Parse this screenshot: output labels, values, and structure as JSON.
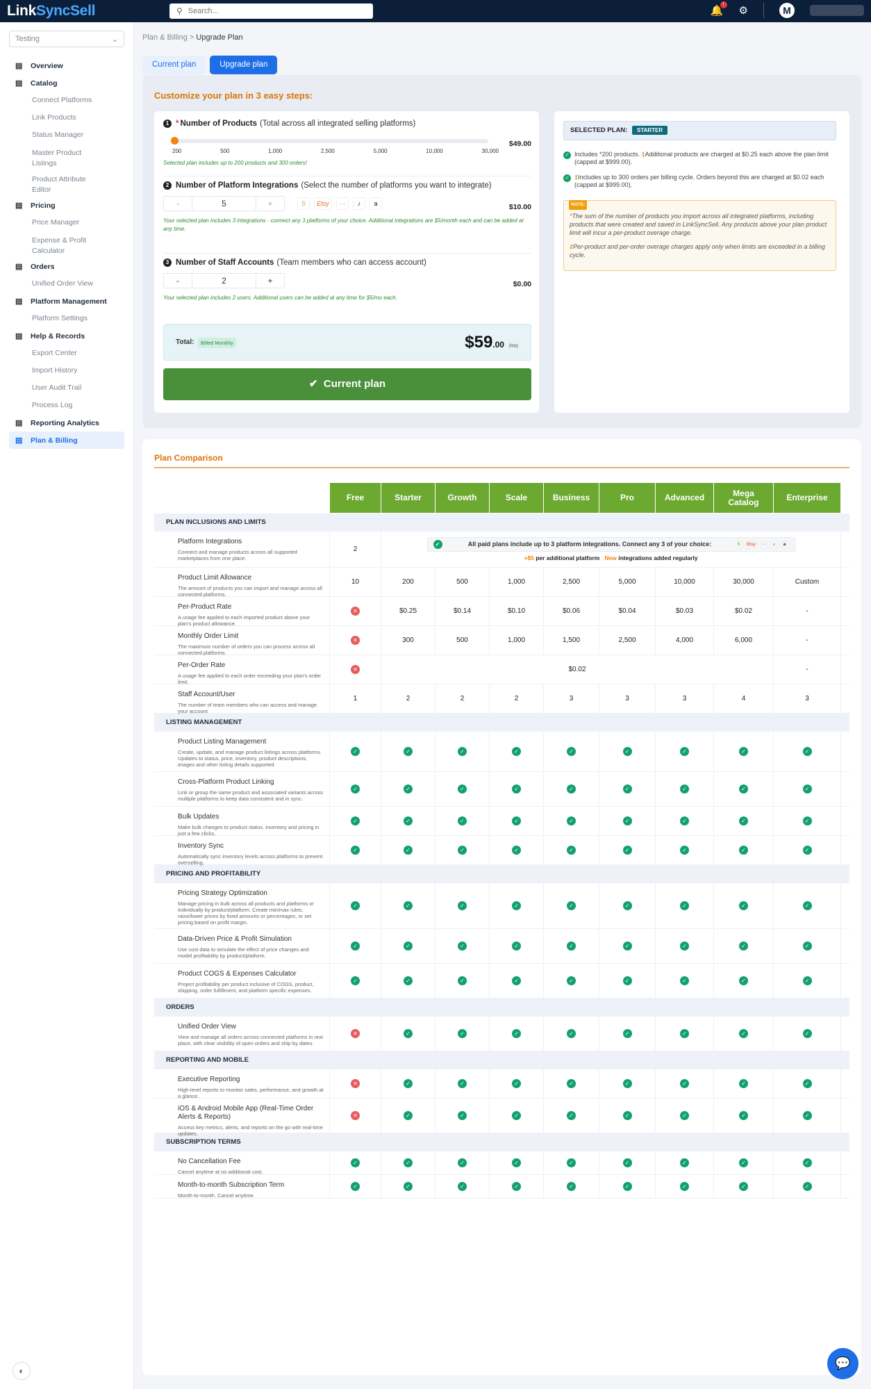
{
  "app": {
    "logo_a": "Link",
    "logo_b": "SyncSell",
    "search_placeholder": "Search...",
    "notifications": "!",
    "avatar": "M"
  },
  "sidebar": {
    "workspace": "Testing",
    "items": [
      {
        "label": "Overview",
        "icon": "document-search-icon",
        "subs": []
      },
      {
        "label": "Catalog",
        "icon": "catalog-icon",
        "subs": [
          "Connect Platforms",
          "Link Products",
          "Status Manager",
          "Master Product Listings",
          "Product Attribute Editor"
        ]
      },
      {
        "label": "Pricing",
        "icon": "pricing-icon",
        "subs": [
          "Price Manager",
          "Expense & Profit Calculator"
        ]
      },
      {
        "label": "Orders",
        "icon": "orders-icon",
        "subs": [
          "Unified Order View"
        ]
      },
      {
        "label": "Platform Management",
        "icon": "platform-icon",
        "subs": [
          "Platform Settings"
        ]
      },
      {
        "label": "Help & Records",
        "icon": "help-records-icon",
        "subs": [
          "Export Center",
          "Import History",
          "User Audit Trail",
          "Process Log"
        ]
      },
      {
        "label": "Reporting Analytics",
        "icon": "analytics-icon",
        "subs": []
      },
      {
        "label": "Plan & Billing",
        "icon": "billing-icon",
        "subs": [],
        "active": true
      }
    ]
  },
  "breadcrumb": {
    "parent": "Plan & Billing",
    "sep": ">",
    "current": "Upgrade Plan"
  },
  "tabs": {
    "current": "Current plan",
    "upgrade": "Upgrade plan"
  },
  "customize": {
    "title": "Customize your plan in 3 easy steps:",
    "step1": {
      "num": "1",
      "req": "*",
      "title": "Number of Products",
      "sub": "(Total across all integrated selling platforms)",
      "price": "$49.00",
      "ticks": [
        "200",
        "500",
        "1,000",
        "2,500",
        "5,000",
        "10,000",
        "30,000"
      ],
      "note": "Selected plan includes up to 200 products and 300 orders!"
    },
    "step2": {
      "num": "2",
      "title": "Number of Platform Integrations",
      "sub": "(Select the number of platforms you want to integrate)",
      "value": "5",
      "minus": "-",
      "plus": "+",
      "price": "$10.00",
      "note": "Your selected plan includes 3 integrations - connect any 3 platforms of your choice. Additional integrations are $5/month each and can be added at any time.",
      "logos": [
        "S",
        "Etsy",
        "···",
        "♪",
        "a"
      ]
    },
    "step3": {
      "num": "3",
      "title": "Number of Staff Accounts",
      "sub": "(Team members who can access account)",
      "value": "2",
      "minus": "-",
      "plus": "+",
      "price": "$0.00",
      "note": "Your selected plan includes 2 users. Additional users can be added at any time for $5/mo each."
    },
    "total": {
      "label": "Total:",
      "badge": "Billed Monthly",
      "amount": "$59",
      "cents": ".00",
      "per": "/mo"
    },
    "button": "Current plan",
    "selected": {
      "label": "SELECTED PLAN:",
      "plan": "STARTER",
      "inc1a": "Includes ",
      "inc1b": "*200 products. ",
      "inc1c": "‡",
      "inc1d": "Additional products are charged at $0.25 each above the plan limit (capped at $999.00).",
      "inc2a": "‡",
      "inc2b": "Includes up to 300 orders per billing cycle. Orders beyond this are charged at $0.02 each (capped at $999.00).",
      "note_tag": "NOTE:",
      "note1a": "*",
      "note1b": "The sum of the number of products you import across all integrated platforms, including products that were created and saved in LinkSyncSell. Any products above your plan product limit will incur a per-product overage charge.",
      "note2a": "‡",
      "note2b": "Per-product and per-order overage charges apply only when limits are exceeded in a billing cycle."
    }
  },
  "comparison": {
    "title": "Plan Comparison",
    "plans": [
      "Free",
      "Starter",
      "Growth",
      "Scale",
      "Business",
      "Pro",
      "Advanced",
      "Mega Catalog",
      "Enterprise"
    ],
    "sections": [
      {
        "name": "PLAN INCLUSIONS AND LIMITS",
        "rows": [
          {
            "title": "Platform Integrations",
            "desc": "Connect and manage products across all supported marketplaces from one place.",
            "free": "2",
            "banner": "All paid plans include up to 3 platform integrations. Connect any 3 of your choice:",
            "extra_a": "+$5",
            "extra_b": " per additional platform",
            "extra_c": "New",
            "extra_d": " integrations added regularly"
          },
          {
            "title": "Product Limit Allowance",
            "desc": "The amount of products you can import and manage across all connected platforms.",
            "cells": [
              "10",
              "200",
              "500",
              "1,000",
              "2,500",
              "5,000",
              "10,000",
              "30,000",
              "Custom"
            ]
          },
          {
            "title": "Per-Product Rate",
            "desc": "A usage fee applied to each imported product above your plan's product allowance.",
            "cells": [
              "x",
              "$0.25",
              "$0.14",
              "$0.10",
              "$0.06",
              "$0.04",
              "$0.03",
              "$0.02",
              "-"
            ]
          },
          {
            "title": "Monthly Order Limit",
            "desc": "The maximum number of orders you can process across all connected platforms.",
            "cells": [
              "x",
              "300",
              "500",
              "1,000",
              "1,500",
              "2,500",
              "4,000",
              "6,000",
              "-"
            ]
          },
          {
            "title": "Per-Order Rate",
            "desc": "A usage fee applied to each order exceeding your plan's order limit.",
            "free": "x",
            "span_value": "$0.02",
            "last": "-"
          },
          {
            "title": "Staff Account/User",
            "desc": "The number of team members who can access and manage your account",
            "cells": [
              "1",
              "2",
              "2",
              "2",
              "3",
              "3",
              "3",
              "4",
              "3"
            ]
          }
        ]
      },
      {
        "name": "LISTING MANAGEMENT",
        "rows": [
          {
            "title": "Product Listing Management",
            "desc": "Create, update, and manage product listings across platforms. Updates to status, price, inventory, product descriptions, images and other listing details supported.",
            "cells": [
              "v",
              "v",
              "v",
              "v",
              "v",
              "v",
              "v",
              "v",
              "v"
            ]
          },
          {
            "title": "Cross-Platform Product Linking",
            "desc": "Link or group the same product and associated variants across multiple platforms to keep data consistent and in sync.",
            "cells": [
              "v",
              "v",
              "v",
              "v",
              "v",
              "v",
              "v",
              "v",
              "v"
            ]
          },
          {
            "title": "Bulk Updates",
            "desc": "Make bulk changes to product status, inventory and pricing in just a few clicks.",
            "cells": [
              "v",
              "v",
              "v",
              "v",
              "v",
              "v",
              "v",
              "v",
              "v"
            ]
          },
          {
            "title": "Inventory Sync",
            "desc": "Automatically sync inventory levels across platforms to prevent overselling.",
            "cells": [
              "v",
              "v",
              "v",
              "v",
              "v",
              "v",
              "v",
              "v",
              "v"
            ]
          }
        ]
      },
      {
        "name": "PRICING AND PROFITABILITY",
        "rows": [
          {
            "title": "Pricing Strategy Optimization",
            "desc": "Manage pricing in bulk across all products and platforms or individually by product/platform. Create min/max rules, raise/lower prices by fixed amounts or percentages, or set pricing based on profit margin.",
            "cells": [
              "v",
              "v",
              "v",
              "v",
              "v",
              "v",
              "v",
              "v",
              "v"
            ]
          },
          {
            "title": "Data-Driven Price & Profit Simulation",
            "desc": "Use cost data to simulate the effect of price changes and model profitability by product/platform.",
            "cells": [
              "v",
              "v",
              "v",
              "v",
              "v",
              "v",
              "v",
              "v",
              "v"
            ]
          },
          {
            "title": "Product COGS & Expenses Calculator",
            "desc": "Project profitability per product inclusive of COGS, product, shipping, order fulfillment, and platform specific expenses.",
            "cells": [
              "v",
              "v",
              "v",
              "v",
              "v",
              "v",
              "v",
              "v",
              "v"
            ]
          }
        ]
      },
      {
        "name": "ORDERS",
        "rows": [
          {
            "title": "Unified Order View",
            "desc": "View and manage all orders across connected platforms in one place, with clear visibility of open orders and ship-by dates.",
            "cells": [
              "x",
              "v",
              "v",
              "v",
              "v",
              "v",
              "v",
              "v",
              "v"
            ]
          }
        ]
      },
      {
        "name": "REPORTING AND MOBILE",
        "rows": [
          {
            "title": "Executive Reporting",
            "desc": "High-level reports to monitor sales, performance, and growth at a glance.",
            "cells": [
              "x",
              "v",
              "v",
              "v",
              "v",
              "v",
              "v",
              "v",
              "v"
            ]
          },
          {
            "title": "iOS & Android Mobile App (Real-Time Order Alerts & Reports)",
            "desc": "Access key metrics, alerts, and reports on the go with real-time updates.",
            "cells": [
              "x",
              "v",
              "v",
              "v",
              "v",
              "v",
              "v",
              "v",
              "v"
            ]
          }
        ]
      },
      {
        "name": "SUBSCRIPTION TERMS",
        "rows": [
          {
            "title": "No Cancellation Fee",
            "desc": "Cancel anytime at no additional cost.",
            "cells": [
              "v",
              "v",
              "v",
              "v",
              "v",
              "v",
              "v",
              "v",
              "v"
            ]
          },
          {
            "title": "Month-to-month Subscription Term",
            "desc": "Month-to-month. Cancel anytime.",
            "cells": [
              "v",
              "v",
              "v",
              "v",
              "v",
              "v",
              "v",
              "v",
              "v"
            ]
          }
        ]
      }
    ]
  },
  "colors": {
    "accent": "#1e6ee8",
    "orange": "#d97706",
    "green": "#6ca930",
    "button_green": "#4a8f3a",
    "check": "#14a06b",
    "cross": "#e45c5c",
    "topbar": "#0b1f3a"
  }
}
